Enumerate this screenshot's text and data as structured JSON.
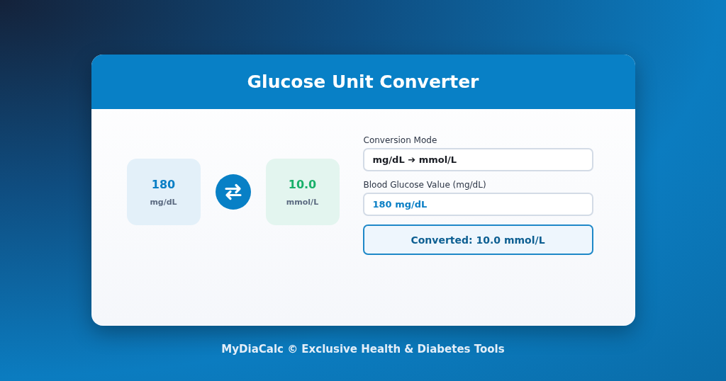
{
  "card": {
    "title": "Glucose Unit Converter"
  },
  "tiles": [
    {
      "kind": "source",
      "value": "180",
      "unit": "mg/dL"
    },
    {
      "kind": "target",
      "value": "10.0",
      "unit": "mmol/L"
    }
  ],
  "form": {
    "mode_label": "Conversion Mode",
    "mode_value": "mg/dL ➔ mmol/L",
    "value_label": "Blood Glucose Value (mg/dL)",
    "value": "180 mg/dL",
    "result": "Converted: 10.0 mmol/L"
  },
  "footer": "MyDiaCalc © Exclusive Health & Diabetes Tools"
}
